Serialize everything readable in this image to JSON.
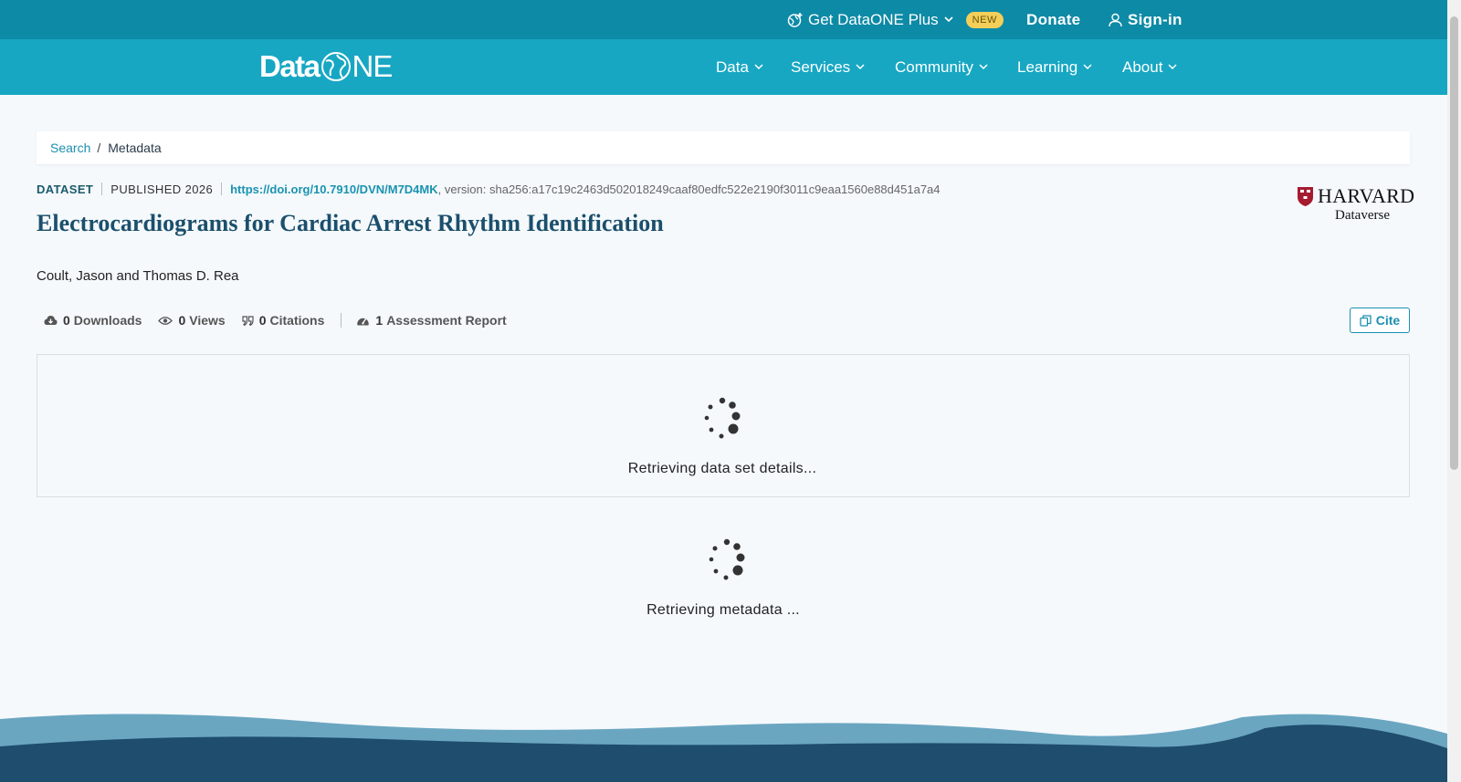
{
  "topbar": {
    "plus_label": "Get DataONE Plus",
    "new_badge": "NEW",
    "donate_label": "Donate",
    "signin_label": "Sign-in"
  },
  "navbar": {
    "logo_data": "Data",
    "logo_one": "NE",
    "items": [
      {
        "label": "Data"
      },
      {
        "label": "Services"
      },
      {
        "label": "Community"
      },
      {
        "label": "Learning"
      },
      {
        "label": "About"
      }
    ]
  },
  "breadcrumb": {
    "search": "Search",
    "separator": "/",
    "current": "Metadata"
  },
  "dataset": {
    "type": "DATASET",
    "published": "PUBLISHED 2026",
    "doi": "https://doi.org/10.7910/DVN/M7D4MK",
    "version": ", version: sha256:a17c19c2463d502018249caaf80edfc522e2190f3011c9eaa1560e88d451a7a4",
    "title": "Electrocardiograms for Cardiac Arrest Rhythm Identification",
    "authors": "Coult, Jason and Thomas D. Rea"
  },
  "repository": {
    "name": "HARVARD",
    "sub": "Dataverse"
  },
  "metrics": {
    "downloads": {
      "count": "0",
      "label": "Downloads"
    },
    "views": {
      "count": "0",
      "label": "Views"
    },
    "citations": {
      "count": "0",
      "label": "Citations"
    },
    "assessment": {
      "count": "1",
      "label": "Assessment Report"
    }
  },
  "cite_label": "Cite",
  "loading": {
    "details": "Retrieving data set details...",
    "metadata": "Retrieving metadata ..."
  },
  "colors": {
    "topbar": "#0d8aa6",
    "navbar": "#17a7c3",
    "title": "#1b4f6c",
    "link": "#1b8fb0",
    "badge": "#f3cf5a"
  }
}
